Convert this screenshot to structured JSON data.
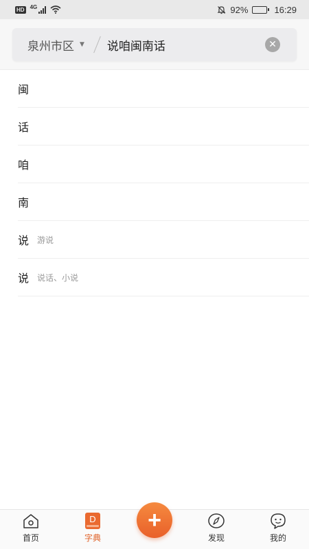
{
  "status_bar": {
    "hd": "HD",
    "network": "4G",
    "battery_percent": "92%",
    "battery_level": 0.92,
    "time": "16:29"
  },
  "search": {
    "region": "泉州市区",
    "query": "说咱闽南话"
  },
  "results": [
    {
      "char": "闽",
      "hint": ""
    },
    {
      "char": "话",
      "hint": ""
    },
    {
      "char": "咱",
      "hint": ""
    },
    {
      "char": "南",
      "hint": ""
    },
    {
      "char": "说",
      "hint": "游说"
    },
    {
      "char": "说",
      "hint": "说话、小说"
    }
  ],
  "tabs": {
    "home": "首页",
    "dictionary": "字典",
    "dictionary_icon_letter": "D",
    "add": "+",
    "discover": "发现",
    "mine": "我的",
    "active": "dictionary",
    "accent_color": "#e0632a"
  }
}
